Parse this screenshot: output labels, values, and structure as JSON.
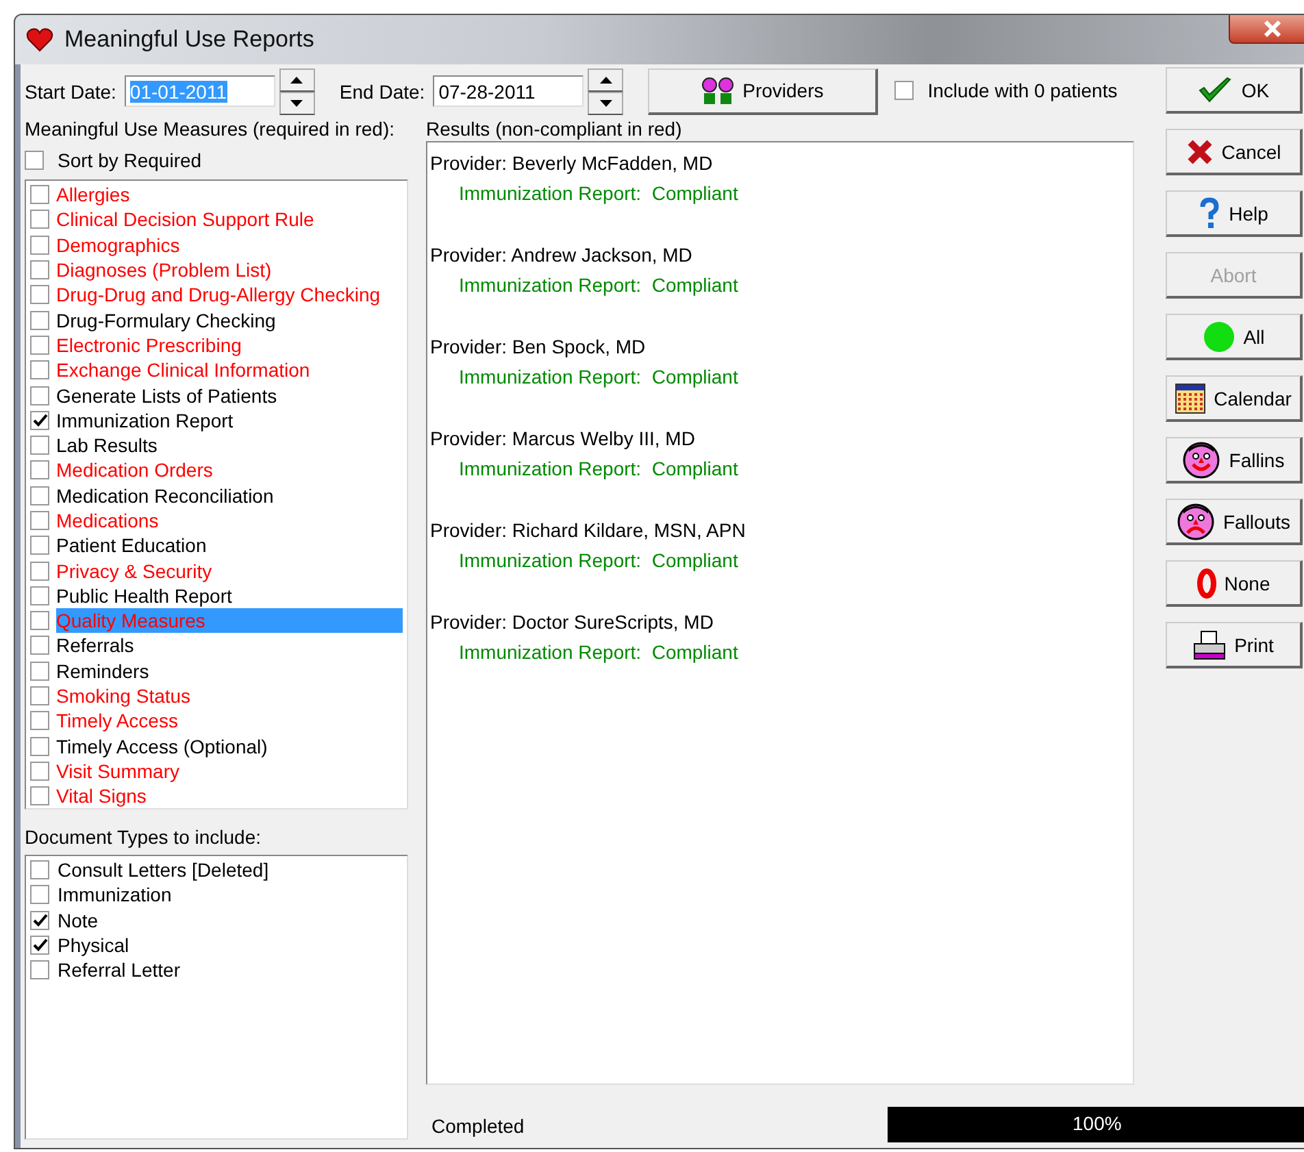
{
  "window": {
    "title": "Meaningful Use Reports"
  },
  "start_date": {
    "label": "Start Date:",
    "value": "01-01-2011",
    "selected": true
  },
  "end_date": {
    "label": "End Date:",
    "value": "07-28-2011",
    "selected": false
  },
  "providers_button": {
    "label": "Providers"
  },
  "include_zero": {
    "label": "Include with 0 patients",
    "checked": false
  },
  "measures_label": "Meaningful Use Measures (required in red):",
  "sort_by_required": {
    "label": "Sort by Required",
    "checked": false
  },
  "measures": [
    {
      "label": "Allergies",
      "required": true,
      "checked": false,
      "selected": false
    },
    {
      "label": "Clinical Decision Support Rule",
      "required": true,
      "checked": false,
      "selected": false
    },
    {
      "label": "Demographics",
      "required": true,
      "checked": false,
      "selected": false
    },
    {
      "label": "Diagnoses (Problem List)",
      "required": true,
      "checked": false,
      "selected": false
    },
    {
      "label": "Drug-Drug and Drug-Allergy Checking",
      "required": true,
      "checked": false,
      "selected": false
    },
    {
      "label": "Drug-Formulary Checking",
      "required": false,
      "checked": false,
      "selected": false
    },
    {
      "label": "Electronic Prescribing",
      "required": true,
      "checked": false,
      "selected": false
    },
    {
      "label": "Exchange Clinical Information",
      "required": true,
      "checked": false,
      "selected": false
    },
    {
      "label": "Generate Lists of Patients",
      "required": false,
      "checked": false,
      "selected": false
    },
    {
      "label": "Immunization Report",
      "required": false,
      "checked": true,
      "selected": false
    },
    {
      "label": "Lab Results",
      "required": false,
      "checked": false,
      "selected": false
    },
    {
      "label": "Medication Orders",
      "required": true,
      "checked": false,
      "selected": false
    },
    {
      "label": "Medication Reconciliation",
      "required": false,
      "checked": false,
      "selected": false
    },
    {
      "label": "Medications",
      "required": true,
      "checked": false,
      "selected": false
    },
    {
      "label": "Patient Education",
      "required": false,
      "checked": false,
      "selected": false
    },
    {
      "label": "Privacy & Security",
      "required": true,
      "checked": false,
      "selected": false
    },
    {
      "label": "Public Health Report",
      "required": false,
      "checked": false,
      "selected": false
    },
    {
      "label": "Quality Measures",
      "required": true,
      "checked": false,
      "selected": true
    },
    {
      "label": "Referrals",
      "required": false,
      "checked": false,
      "selected": false
    },
    {
      "label": "Reminders",
      "required": false,
      "checked": false,
      "selected": false
    },
    {
      "label": "Smoking Status",
      "required": true,
      "checked": false,
      "selected": false
    },
    {
      "label": "Timely Access",
      "required": true,
      "checked": false,
      "selected": false
    },
    {
      "label": "Timely Access (Optional)",
      "required": false,
      "checked": false,
      "selected": false
    },
    {
      "label": "Visit Summary",
      "required": true,
      "checked": false,
      "selected": false
    },
    {
      "label": "Vital Signs",
      "required": true,
      "checked": false,
      "selected": false
    }
  ],
  "document_types_label": "Document Types to include:",
  "document_types": [
    {
      "label": "Consult Letters [Deleted]",
      "checked": false
    },
    {
      "label": "Immunization",
      "checked": false
    },
    {
      "label": "Note",
      "checked": true
    },
    {
      "label": "Physical",
      "checked": true
    },
    {
      "label": "Referral Letter",
      "checked": false
    }
  ],
  "results_label": "Results (non-compliant in red)",
  "results": [
    {
      "provider": "Provider: Beverly McFadden, MD",
      "report": "Immunization Report:  Compliant",
      "compliant": true
    },
    {
      "provider": "Provider: Andrew Jackson, MD",
      "report": "Immunization Report:  Compliant",
      "compliant": true
    },
    {
      "provider": "Provider: Ben Spock, MD",
      "report": "Immunization Report:  Compliant",
      "compliant": true
    },
    {
      "provider": "Provider: Marcus Welby III, MD",
      "report": "Immunization Report:  Compliant",
      "compliant": true
    },
    {
      "provider": "Provider: Richard Kildare, MSN, APN",
      "report": "Immunization Report:  Compliant",
      "compliant": true
    },
    {
      "provider": "Provider: Doctor SureScripts, MD",
      "report": "Immunization Report:  Compliant",
      "compliant": true
    }
  ],
  "buttons": [
    {
      "kind": "ok",
      "label": "OK",
      "disabled": false
    },
    {
      "kind": "cancel",
      "label": "Cancel",
      "disabled": false
    },
    {
      "kind": "help",
      "label": "Help",
      "disabled": false
    },
    {
      "kind": "abort",
      "label": "Abort",
      "disabled": true
    },
    {
      "kind": "all",
      "label": "All",
      "disabled": false
    },
    {
      "kind": "calendar",
      "label": "Calendar",
      "disabled": false
    },
    {
      "kind": "fallins",
      "label": "Fallins",
      "disabled": false
    },
    {
      "kind": "fallouts",
      "label": "Fallouts",
      "disabled": false
    },
    {
      "kind": "none",
      "label": "None",
      "disabled": false
    },
    {
      "kind": "print",
      "label": "Print",
      "disabled": false
    }
  ],
  "status": {
    "text": "Completed",
    "progress": {
      "level": 1.0,
      "reading": "100%"
    }
  }
}
